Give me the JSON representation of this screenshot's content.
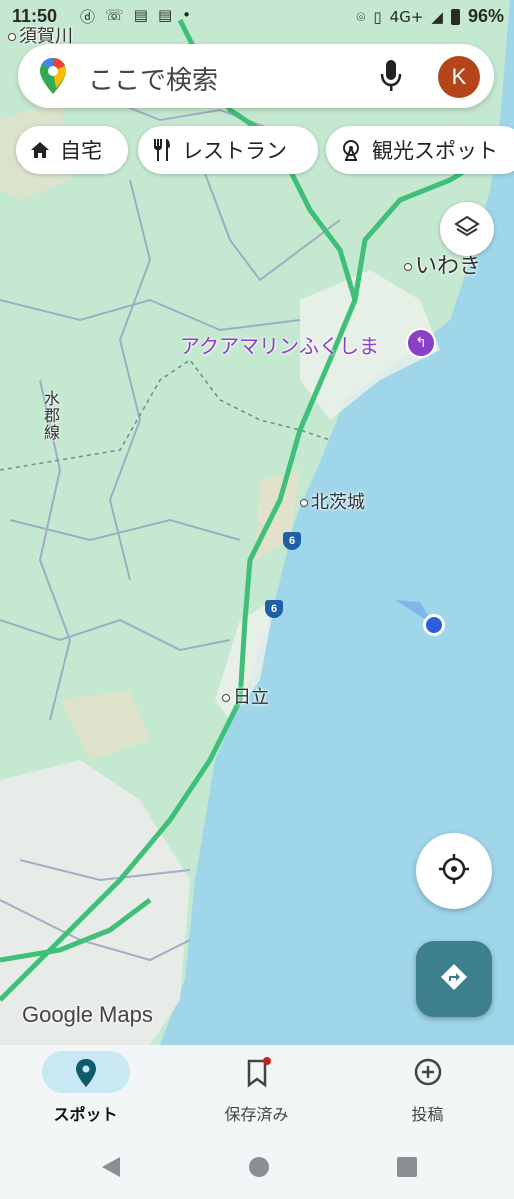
{
  "status_bar": {
    "time": "11:50",
    "network": "4G+",
    "battery": "96%"
  },
  "search": {
    "placeholder": "ここで検索",
    "avatar_letter": "K"
  },
  "chips": [
    {
      "label": "自宅",
      "icon": "home-icon"
    },
    {
      "label": "レストラン",
      "icon": "fork-knife-icon"
    },
    {
      "label": "観光スポット",
      "icon": "ferris-wheel-icon"
    }
  ],
  "map": {
    "labels": {
      "sukagawa": "須賀川",
      "iwaki": "いわき",
      "aquamarine": "アクアマリンふくしま",
      "suigun_line": "水郡線",
      "kitaibaraki": "北茨城",
      "hitachi": "日立"
    },
    "route_number": "6",
    "attribution": "Google Maps",
    "colors": {
      "sea": "#9fd6ea",
      "land": "#c5e8d0",
      "highway": "#3fbf78",
      "poi": "#8a3fc7"
    }
  },
  "bottom_nav": {
    "items": [
      {
        "label": "スポット",
        "icon": "location-pin-icon",
        "active": true
      },
      {
        "label": "保存済み",
        "icon": "bookmark-icon",
        "active": false
      },
      {
        "label": "投稿",
        "icon": "add-circle-icon",
        "active": false
      }
    ]
  }
}
